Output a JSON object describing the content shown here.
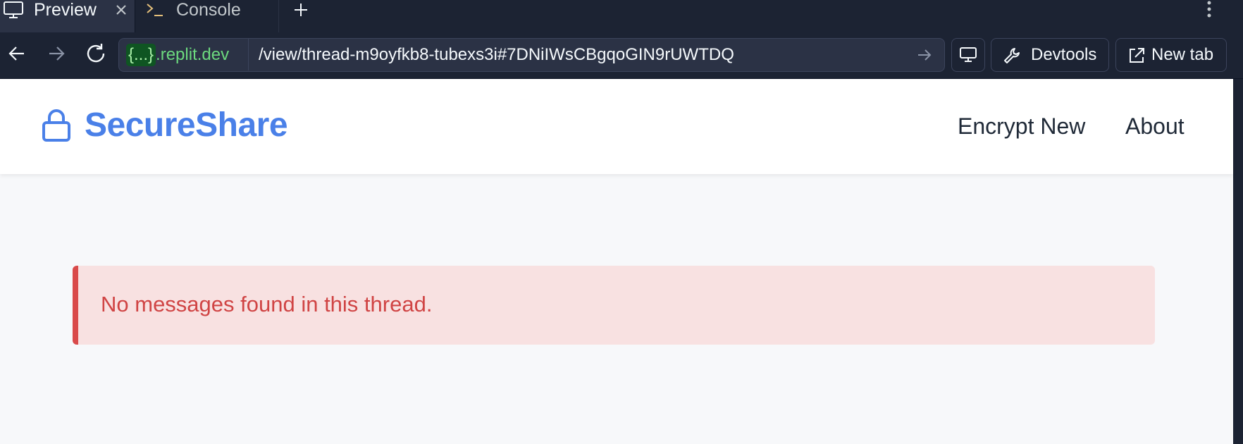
{
  "browser": {
    "tabs": [
      {
        "label": "Preview",
        "icon": "monitor-icon",
        "active": true
      },
      {
        "label": "Console",
        "icon": "terminal-icon",
        "active": false
      }
    ],
    "url": {
      "subdomain": "{...}",
      "domain": ".replit.dev",
      "path": "/view/thread-m9oyfkb8-tubexs3i#7DNiIWsCBgqoGIN9rUWTDQ"
    },
    "devtools_label": "Devtools",
    "newtab_label": "New tab"
  },
  "app": {
    "brand": "SecureShare",
    "nav": [
      {
        "label": "Encrypt New"
      },
      {
        "label": "About"
      }
    ],
    "alert": {
      "message": "No messages found in this thread."
    }
  },
  "colors": {
    "brand": "#4a80e8",
    "alert_bg": "#f8e1e1",
    "alert_border": "#d94a4a",
    "alert_text": "#d04444",
    "chrome_bg": "#1c2333",
    "domain_green": "#6cd97e"
  }
}
